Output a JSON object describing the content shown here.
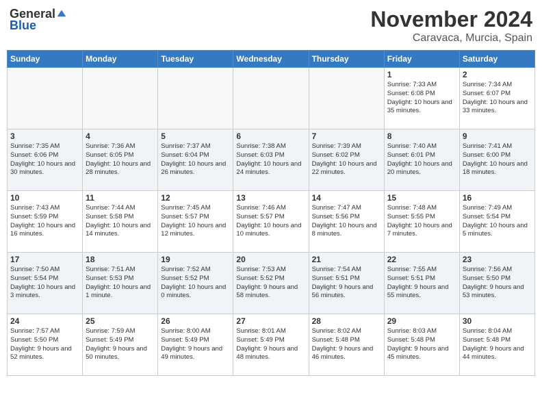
{
  "header": {
    "logo_general": "General",
    "logo_blue": "Blue",
    "month": "November 2024",
    "location": "Caravaca, Murcia, Spain"
  },
  "days_of_week": [
    "Sunday",
    "Monday",
    "Tuesday",
    "Wednesday",
    "Thursday",
    "Friday",
    "Saturday"
  ],
  "weeks": [
    {
      "days": [
        {
          "number": "",
          "empty": true
        },
        {
          "number": "",
          "empty": true
        },
        {
          "number": "",
          "empty": true
        },
        {
          "number": "",
          "empty": true
        },
        {
          "number": "",
          "empty": true
        },
        {
          "number": "1",
          "sunrise": "7:33 AM",
          "sunset": "6:08 PM",
          "daylight": "10 hours and 35 minutes."
        },
        {
          "number": "2",
          "sunrise": "7:34 AM",
          "sunset": "6:07 PM",
          "daylight": "10 hours and 33 minutes."
        }
      ]
    },
    {
      "days": [
        {
          "number": "3",
          "sunrise": "7:35 AM",
          "sunset": "6:06 PM",
          "daylight": "10 hours and 30 minutes."
        },
        {
          "number": "4",
          "sunrise": "7:36 AM",
          "sunset": "6:05 PM",
          "daylight": "10 hours and 28 minutes."
        },
        {
          "number": "5",
          "sunrise": "7:37 AM",
          "sunset": "6:04 PM",
          "daylight": "10 hours and 26 minutes."
        },
        {
          "number": "6",
          "sunrise": "7:38 AM",
          "sunset": "6:03 PM",
          "daylight": "10 hours and 24 minutes."
        },
        {
          "number": "7",
          "sunrise": "7:39 AM",
          "sunset": "6:02 PM",
          "daylight": "10 hours and 22 minutes."
        },
        {
          "number": "8",
          "sunrise": "7:40 AM",
          "sunset": "6:01 PM",
          "daylight": "10 hours and 20 minutes."
        },
        {
          "number": "9",
          "sunrise": "7:41 AM",
          "sunset": "6:00 PM",
          "daylight": "10 hours and 18 minutes."
        }
      ]
    },
    {
      "days": [
        {
          "number": "10",
          "sunrise": "7:43 AM",
          "sunset": "5:59 PM",
          "daylight": "10 hours and 16 minutes."
        },
        {
          "number": "11",
          "sunrise": "7:44 AM",
          "sunset": "5:58 PM",
          "daylight": "10 hours and 14 minutes."
        },
        {
          "number": "12",
          "sunrise": "7:45 AM",
          "sunset": "5:57 PM",
          "daylight": "10 hours and 12 minutes."
        },
        {
          "number": "13",
          "sunrise": "7:46 AM",
          "sunset": "5:57 PM",
          "daylight": "10 hours and 10 minutes."
        },
        {
          "number": "14",
          "sunrise": "7:47 AM",
          "sunset": "5:56 PM",
          "daylight": "10 hours and 8 minutes."
        },
        {
          "number": "15",
          "sunrise": "7:48 AM",
          "sunset": "5:55 PM",
          "daylight": "10 hours and 7 minutes."
        },
        {
          "number": "16",
          "sunrise": "7:49 AM",
          "sunset": "5:54 PM",
          "daylight": "10 hours and 5 minutes."
        }
      ]
    },
    {
      "days": [
        {
          "number": "17",
          "sunrise": "7:50 AM",
          "sunset": "5:54 PM",
          "daylight": "10 hours and 3 minutes."
        },
        {
          "number": "18",
          "sunrise": "7:51 AM",
          "sunset": "5:53 PM",
          "daylight": "10 hours and 1 minute."
        },
        {
          "number": "19",
          "sunrise": "7:52 AM",
          "sunset": "5:52 PM",
          "daylight": "10 hours and 0 minutes."
        },
        {
          "number": "20",
          "sunrise": "7:53 AM",
          "sunset": "5:52 PM",
          "daylight": "9 hours and 58 minutes."
        },
        {
          "number": "21",
          "sunrise": "7:54 AM",
          "sunset": "5:51 PM",
          "daylight": "9 hours and 56 minutes."
        },
        {
          "number": "22",
          "sunrise": "7:55 AM",
          "sunset": "5:51 PM",
          "daylight": "9 hours and 55 minutes."
        },
        {
          "number": "23",
          "sunrise": "7:56 AM",
          "sunset": "5:50 PM",
          "daylight": "9 hours and 53 minutes."
        }
      ]
    },
    {
      "days": [
        {
          "number": "24",
          "sunrise": "7:57 AM",
          "sunset": "5:50 PM",
          "daylight": "9 hours and 52 minutes."
        },
        {
          "number": "25",
          "sunrise": "7:59 AM",
          "sunset": "5:49 PM",
          "daylight": "9 hours and 50 minutes."
        },
        {
          "number": "26",
          "sunrise": "8:00 AM",
          "sunset": "5:49 PM",
          "daylight": "9 hours and 49 minutes."
        },
        {
          "number": "27",
          "sunrise": "8:01 AM",
          "sunset": "5:49 PM",
          "daylight": "9 hours and 48 minutes."
        },
        {
          "number": "28",
          "sunrise": "8:02 AM",
          "sunset": "5:48 PM",
          "daylight": "9 hours and 46 minutes."
        },
        {
          "number": "29",
          "sunrise": "8:03 AM",
          "sunset": "5:48 PM",
          "daylight": "9 hours and 45 minutes."
        },
        {
          "number": "30",
          "sunrise": "8:04 AM",
          "sunset": "5:48 PM",
          "daylight": "9 hours and 44 minutes."
        }
      ]
    }
  ]
}
